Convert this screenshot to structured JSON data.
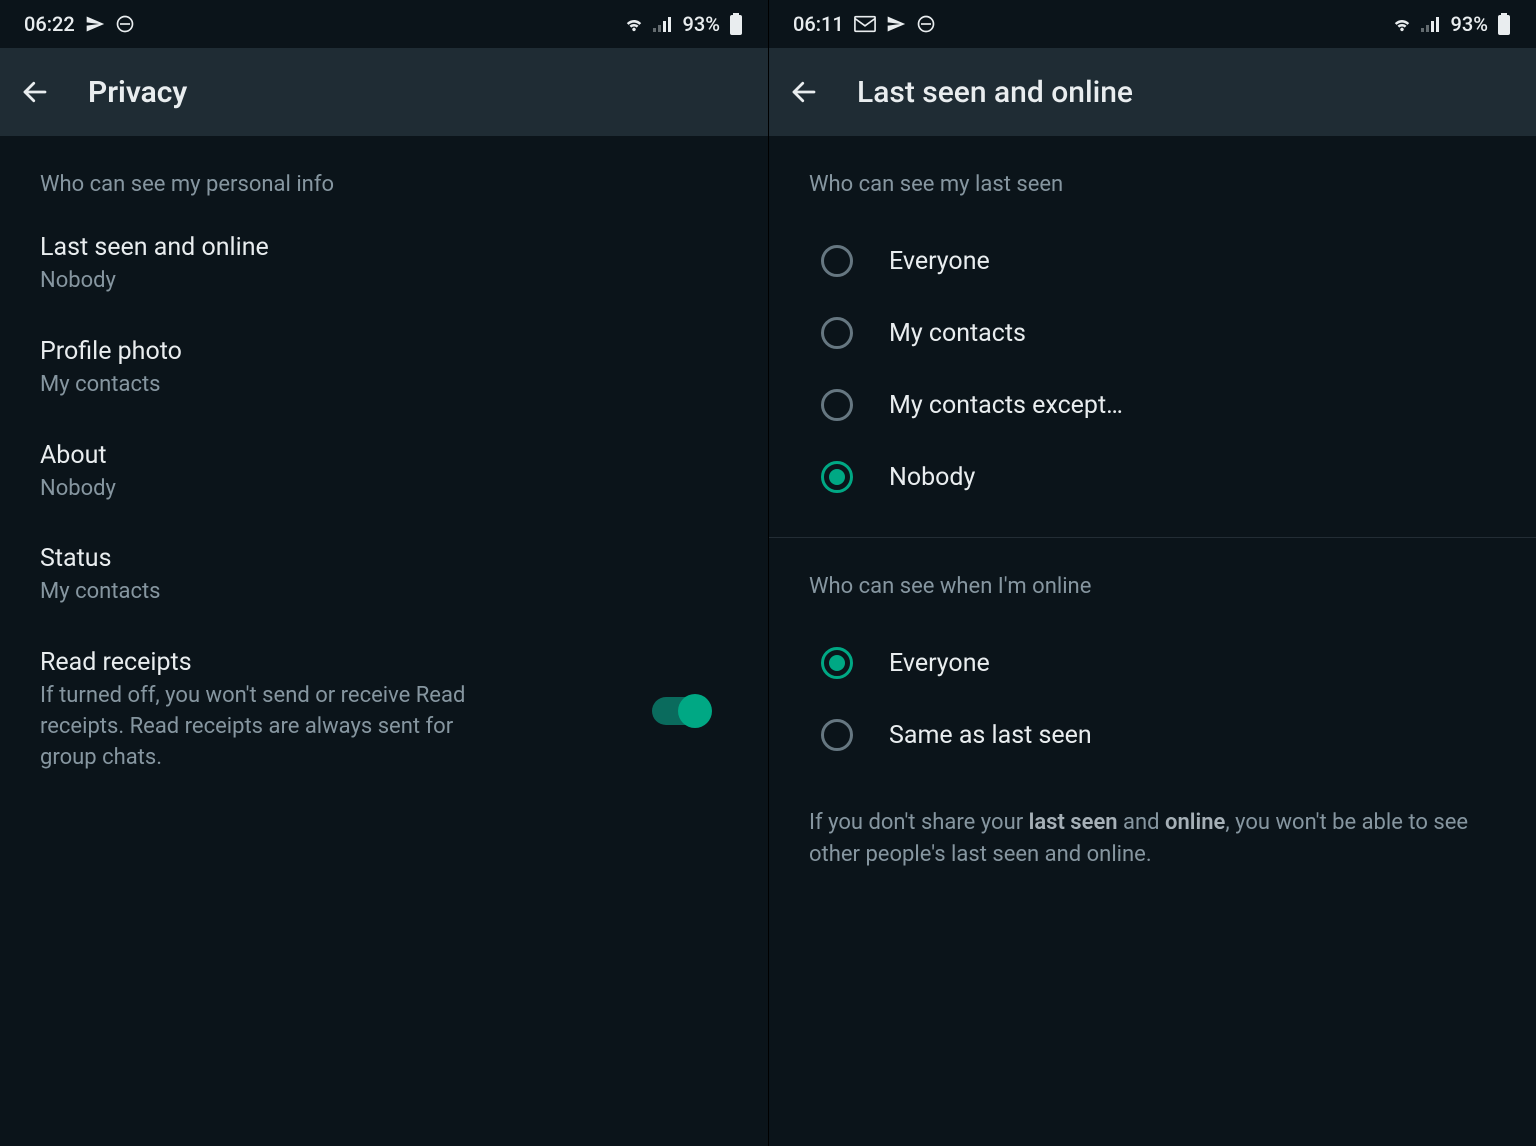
{
  "left": {
    "statusbar": {
      "time": "06:22",
      "battery": "93%"
    },
    "appbar": {
      "title": "Privacy"
    },
    "section_header": "Who can see my personal info",
    "items": [
      {
        "title": "Last seen and online",
        "sub": "Nobody"
      },
      {
        "title": "Profile photo",
        "sub": "My contacts"
      },
      {
        "title": "About",
        "sub": "Nobody"
      },
      {
        "title": "Status",
        "sub": "My contacts"
      },
      {
        "title": "Read receipts",
        "sub": "If turned off, you won't send or receive Read receipts. Read receipts are always sent for group chats."
      }
    ]
  },
  "right": {
    "statusbar": {
      "time": "06:11",
      "battery": "93%"
    },
    "appbar": {
      "title": "Last seen and online"
    },
    "section1_header": "Who can see my last seen",
    "section1_options": [
      {
        "label": "Everyone",
        "selected": false
      },
      {
        "label": "My contacts",
        "selected": false
      },
      {
        "label": "My contacts except…",
        "selected": false
      },
      {
        "label": "Nobody",
        "selected": true
      }
    ],
    "section2_header": "Who can see when I'm online",
    "section2_options": [
      {
        "label": "Everyone",
        "selected": true
      },
      {
        "label": "Same as last seen",
        "selected": false
      }
    ],
    "footnote_pre": "If you don't share your ",
    "footnote_bold1": "last seen",
    "footnote_mid": " and ",
    "footnote_bold2": "online",
    "footnote_post": ", you won't be able to see other people's last seen and online."
  }
}
